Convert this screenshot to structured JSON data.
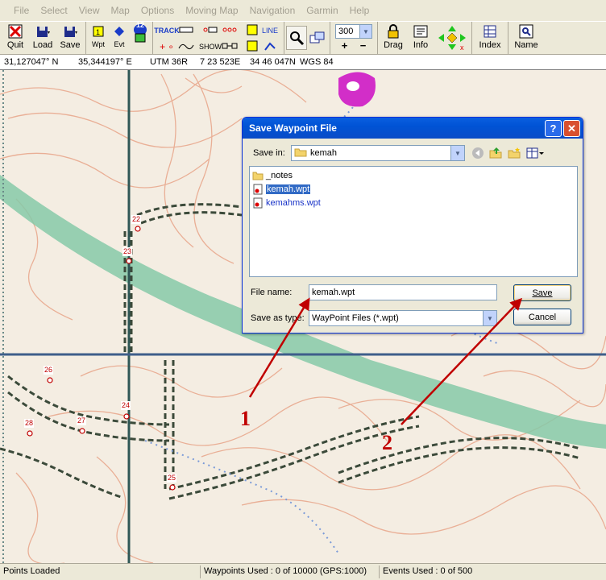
{
  "menu": [
    "File",
    "Select",
    "View",
    "Map",
    "Options",
    "Moving Map",
    "Navigation",
    "Garmin",
    "Help"
  ],
  "toolbar": {
    "quit_label": "Quit",
    "load_label": "Load",
    "save_label": "Save",
    "wpt_label": "Wpt",
    "evt_label": "Evt",
    "badge_number": "12",
    "track_label": "TRACK",
    "show_label": "SHOW",
    "line_label": "LINE",
    "zoom_value": "300",
    "zoom_in_symbol": "+",
    "zoom_out_symbol": "−",
    "drag_label": "Drag",
    "info_label": "Info",
    "index_label": "Index",
    "name_label": "Name"
  },
  "coords": {
    "lat": "31,127047° N",
    "lon": "35,344197° E",
    "utm_prefix": "UTM  36R",
    "easting": "7 23 523E",
    "northing": "34 46 047N",
    "datum": "WGS 84"
  },
  "waypoints": [
    {
      "label": "22"
    },
    {
      "label": "23"
    },
    {
      "label": "24"
    },
    {
      "label": "25"
    },
    {
      "label": "26"
    },
    {
      "label": "27"
    },
    {
      "label": "28"
    }
  ],
  "dialog": {
    "title": "Save Waypoint File",
    "help_symbol": "?",
    "close_symbol": "✕",
    "save_in_label": "Save in:",
    "save_in_value": "kemah",
    "files": [
      {
        "name": "_notes",
        "type": "folder"
      },
      {
        "name": "kemah.wpt",
        "type": "file",
        "selected": true
      },
      {
        "name": "kemahms.wpt",
        "type": "file"
      }
    ],
    "file_name_label": "File name:",
    "file_name_value": "kemah.wpt",
    "save_as_type_label": "Save as type:",
    "save_as_type_value": "WayPoint Files (*.wpt)",
    "save_button": "Save",
    "cancel_button": "Cancel"
  },
  "annotations": [
    "1",
    "2"
  ],
  "status": {
    "left": "Points Loaded",
    "waypoints": "Waypoints Used : 0 of 10000  (GPS:1000)",
    "events": "Events Used : 0 of 500"
  },
  "colors": {
    "menu_disabled": "#a39f91",
    "title_bar": "#0053d5",
    "selection": "#316ac5",
    "annotation_red": "#c00000",
    "map_green": "#7fc4a4",
    "map_road": "#1e4a4a"
  }
}
